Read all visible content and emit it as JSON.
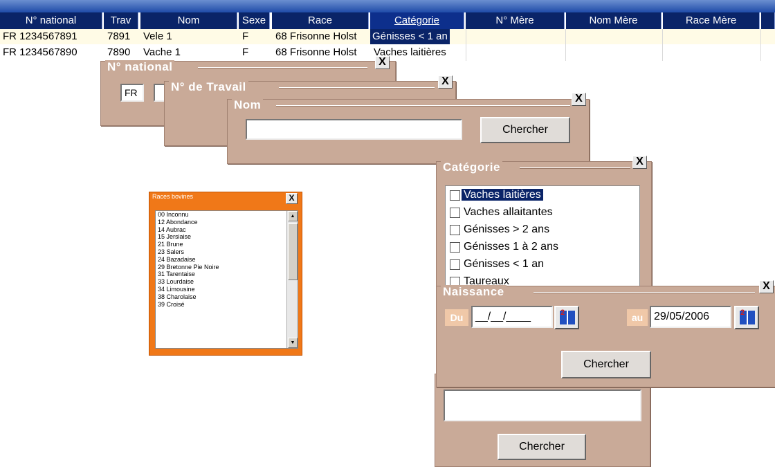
{
  "grid": {
    "headers": [
      "N° national",
      "Trav",
      "Nom",
      "Sexe",
      "Race",
      "Catégorie",
      "N° Mère",
      "Nom Mère",
      "Race Mère"
    ],
    "rows": [
      [
        "FR 1234567891",
        "7891",
        "Vele 1",
        "F",
        "68 Frisonne Holst",
        "Génisses < 1 an"
      ],
      [
        "FR 1234567890",
        "7890",
        "Vache 1",
        "F",
        "68 Frisonne Holst",
        "Vaches laitières"
      ]
    ]
  },
  "win_national": {
    "title": "N° national",
    "prefix": "FR",
    "close": "X"
  },
  "win_travail": {
    "title": "N° de Travail",
    "close": "X"
  },
  "win_nom": {
    "title": "Nom",
    "value": "",
    "button": "Chercher",
    "close": "X"
  },
  "win_categorie": {
    "title": "Catégorie",
    "close": "X",
    "items": [
      "Vaches laitières",
      "Vaches allaitantes",
      "Génisses > 2 ans",
      "Génisses 1 à 2 ans",
      "Génisses < 1 an",
      "Taureaux"
    ]
  },
  "win_naissance": {
    "title": "Naissance",
    "close": "X",
    "du_label": "Du",
    "du_value": "__/__/____",
    "au_label": "au",
    "au_value": "29/05/2006",
    "button": "Chercher"
  },
  "win_bottom": {
    "value": "",
    "button": "Chercher"
  },
  "win_race": {
    "title": "Races bovines",
    "close": "X",
    "items": [
      "00 Inconnu",
      "12 Abondance",
      "14 Aubrac",
      "15 Jersiaise",
      "21 Brune",
      "23 Salers",
      "24 Bazadaise",
      "29 Bretonne Pie Noire",
      "31 Tarentaise",
      "33 Lourdaise",
      "34 Limousine",
      "38 Charolaise",
      "39 Croisé"
    ]
  },
  "colors": {
    "header_bg": "#0a2468",
    "window_bg": "#c9aa98",
    "race_bg": "#f07818"
  }
}
